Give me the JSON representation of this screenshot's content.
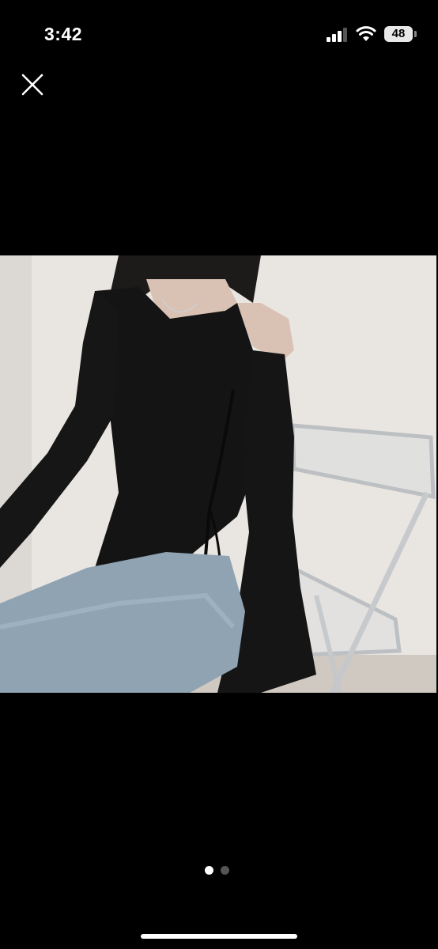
{
  "status_bar": {
    "time": "3:42",
    "battery_level": "48",
    "icons": [
      "signal-icon",
      "wifi-icon",
      "battery-icon"
    ]
  },
  "toolbar": {
    "close_icon": "close-icon"
  },
  "gallery": {
    "current_index": 1,
    "total": 2,
    "share_icon": "share-icon"
  },
  "colors": {
    "background": "#000000",
    "dot_active": "#ffffff",
    "dot_inactive": "#555555"
  }
}
